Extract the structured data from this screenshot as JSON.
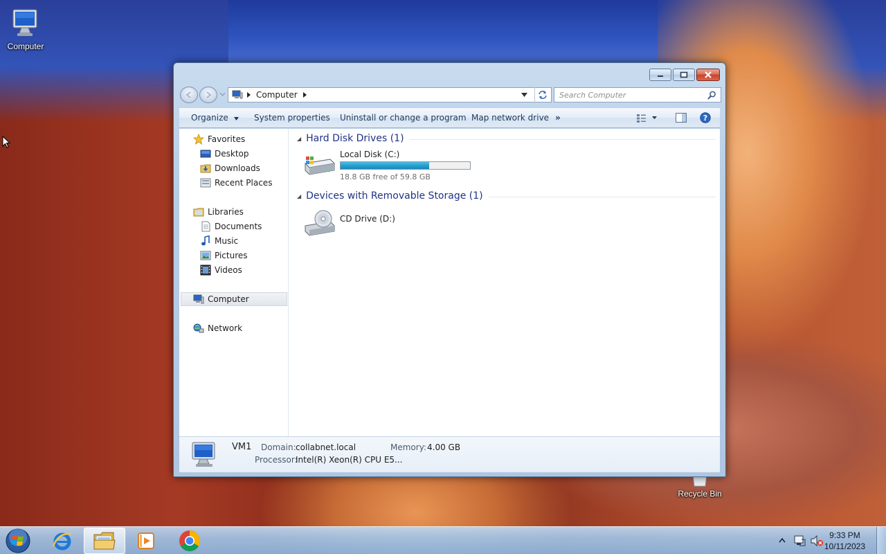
{
  "desktop": {
    "icons": [
      {
        "label": "Computer"
      },
      {
        "label": "Recycle Bin"
      }
    ]
  },
  "window": {
    "address": {
      "location": "Computer"
    },
    "search": {
      "placeholder": "Search Computer"
    },
    "toolbar": {
      "organize": "Organize",
      "system_properties": "System properties",
      "uninstall": "Uninstall or change a program",
      "map_drive": "Map network drive",
      "more": "»"
    },
    "nav": {
      "favorites": {
        "label": "Favorites",
        "items": [
          "Desktop",
          "Downloads",
          "Recent Places"
        ]
      },
      "libraries": {
        "label": "Libraries",
        "items": [
          "Documents",
          "Music",
          "Pictures",
          "Videos"
        ]
      },
      "computer": "Computer",
      "network": "Network"
    },
    "groups": {
      "hdd": {
        "title": "Hard Disk Drives (1)",
        "drive": {
          "name": "Local Disk (C:)",
          "free_text": "18.8 GB free of 59.8 GB",
          "used_fraction": 0.686
        }
      },
      "removable": {
        "title": "Devices with Removable Storage (1)",
        "drive": {
          "name": "CD Drive (D:)"
        }
      }
    },
    "details": {
      "name": "VM1",
      "domain_label": "Domain:",
      "domain": "collabnet.local",
      "memory_label": "Memory:",
      "memory": "4.00 GB",
      "processor_label": "Processor:",
      "processor": "Intel(R) Xeon(R) CPU E5..."
    }
  },
  "taskbar": {
    "clock": {
      "time": "9:33 PM",
      "date": "10/11/2023"
    }
  },
  "colors": {
    "accent": "#1e3287",
    "progress": "#26a0d0"
  }
}
